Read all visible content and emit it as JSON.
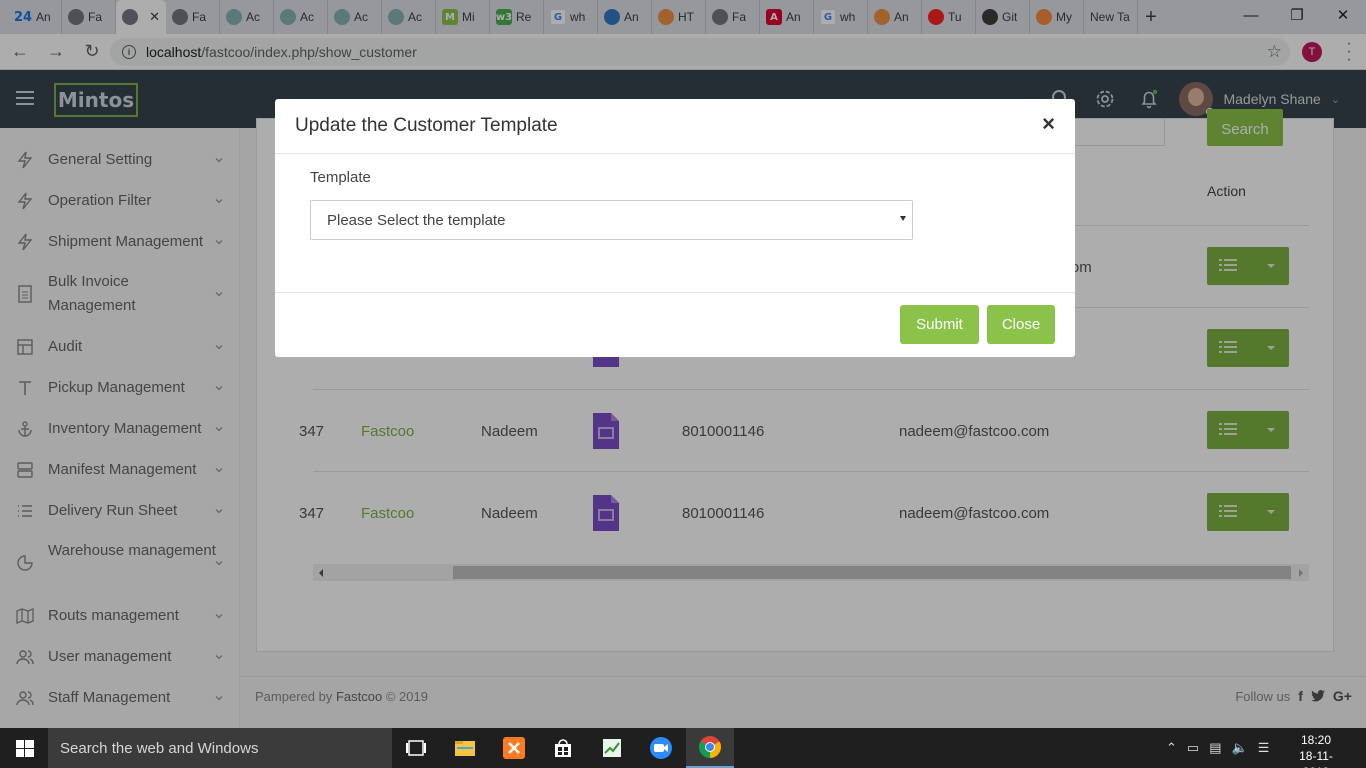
{
  "browser": {
    "tabs": [
      {
        "label": "An",
        "favicon": "24",
        "color": "#1a73e8"
      },
      {
        "label": "Fa",
        "favicon": "globe-icon",
        "color": "#5f6368"
      },
      {
        "label": "",
        "favicon": "globe-icon",
        "color": "#5f6368",
        "active": true
      },
      {
        "label": "Fa",
        "favicon": "globe-icon",
        "color": "#5f6368"
      },
      {
        "label": "Ac",
        "favicon": "leaf-icon",
        "color": "#7aa"
      },
      {
        "label": "Ac",
        "favicon": "leaf-icon",
        "color": "#7aa"
      },
      {
        "label": "Ac",
        "favicon": "leaf-icon",
        "color": "#7aa"
      },
      {
        "label": "Ac",
        "favicon": "leaf-icon",
        "color": "#7aa"
      },
      {
        "label": "Mi",
        "favicon": "M",
        "color": "#8bc34a"
      },
      {
        "label": "Re",
        "favicon": "w3",
        "color": "#4caf50"
      },
      {
        "label": "wh",
        "favicon": "G",
        "color": "#4285f4"
      },
      {
        "label": "An",
        "favicon": "network-icon",
        "color": "#1565c0"
      },
      {
        "label": "HT",
        "favicon": "stack-icon",
        "color": "#f48024"
      },
      {
        "label": "Fa",
        "favicon": "globe-icon",
        "color": "#5f6368"
      },
      {
        "label": "An",
        "favicon": "A",
        "color": "#dd0031"
      },
      {
        "label": "wh",
        "favicon": "G",
        "color": "#4285f4"
      },
      {
        "label": "An",
        "favicon": "stack-icon",
        "color": "#f48024"
      },
      {
        "label": "Tu",
        "favicon": "play-icon",
        "color": "#ff0000"
      },
      {
        "label": "Git",
        "favicon": "github-icon",
        "color": "#222"
      },
      {
        "label": "My",
        "favicon": "xampp-icon",
        "color": "#fb7a24"
      },
      {
        "label": "New Ta",
        "favicon": "",
        "color": ""
      }
    ],
    "url_host": "localhost",
    "url_path": "/fastcoo/index.php/show_customer",
    "profile_initial": "T"
  },
  "app": {
    "logo": "Mintos",
    "user_name": "Madelyn Shane",
    "accent": "#8bc34a"
  },
  "sidebar": {
    "items": [
      {
        "label": "General Setting",
        "icon": "bolt-icon"
      },
      {
        "label": "Operation Filter",
        "icon": "bolt-icon"
      },
      {
        "label": "Shipment Management",
        "icon": "bolt-icon"
      },
      {
        "label": "Bulk Invoice Management",
        "icon": "document-icon"
      },
      {
        "label": "Audit",
        "icon": "layout-icon"
      },
      {
        "label": "Pickup Management",
        "icon": "type-icon"
      },
      {
        "label": "Inventory Management",
        "icon": "anchor-icon"
      },
      {
        "label": "Manifest Management",
        "icon": "server-icon"
      },
      {
        "label": "Delivery Run Sheet",
        "icon": "list-icon"
      },
      {
        "label": "Warehouse management",
        "icon": "pie-icon"
      },
      {
        "label": "Routs management",
        "icon": "map-icon"
      },
      {
        "label": "User management",
        "icon": "users-icon"
      },
      {
        "label": "Staff Management",
        "icon": "users-icon"
      }
    ]
  },
  "table": {
    "search_button": "Search",
    "action_header": "Action",
    "first_row_email_partial": "gamail.com",
    "rows": [
      {
        "id": "347",
        "company": "Fastcoo",
        "name": "Nadeem",
        "phone": "8010001146",
        "email": "nadeem@fastcoo.com"
      },
      {
        "id": "347",
        "company": "Fastcoo",
        "name": "Nadeem",
        "phone": "8010001146",
        "email": "nadeem@fastcoo.com"
      },
      {
        "id": "347",
        "company": "Fastcoo",
        "name": "Nadeem",
        "phone": "8010001146",
        "email": "nadeem@fastcoo.com"
      }
    ]
  },
  "footer": {
    "prefix": "Pampered by",
    "brand": "Fastcoo",
    "suffix": "© 2019",
    "follow": "Follow us"
  },
  "modal": {
    "title": "Update the Customer Template",
    "close_symbol": "×",
    "field_label": "Template",
    "select_value": "Please Select the template",
    "submit_label": "Submit",
    "close_label": "Close"
  },
  "taskbar": {
    "search_placeholder": "Search the web and Windows",
    "time": "18:20",
    "date": "18-11-2019"
  }
}
